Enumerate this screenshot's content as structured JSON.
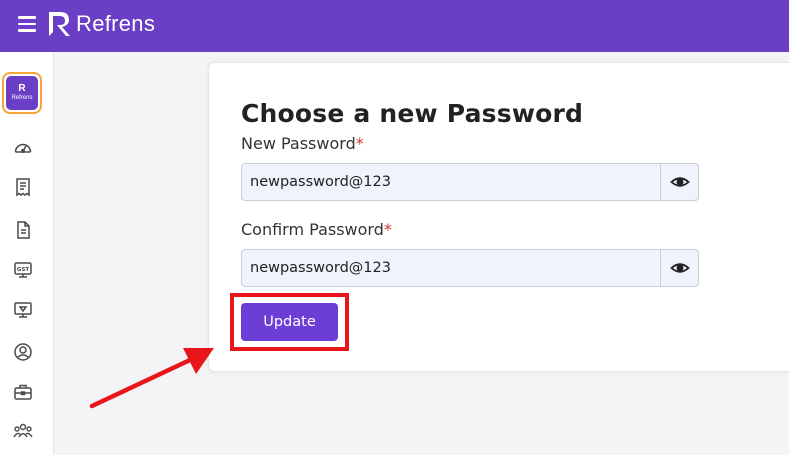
{
  "app": {
    "name": "Refrens",
    "badge_mark": "R",
    "badge_text": "Refrens"
  },
  "sidebar": {
    "items": [
      {
        "icon": "dashboard-gauge-icon"
      },
      {
        "icon": "invoice-icon"
      },
      {
        "icon": "document-icon"
      },
      {
        "icon": "gst-icon",
        "label": "GST"
      },
      {
        "icon": "presentation-icon"
      },
      {
        "icon": "user-circle-icon"
      },
      {
        "icon": "briefcase-icon"
      },
      {
        "icon": "team-icon"
      }
    ]
  },
  "form": {
    "title": "Choose a new Password",
    "new_password": {
      "label": "New Password",
      "required_mark": "*",
      "value": "newpassword@123"
    },
    "confirm_password": {
      "label": "Confirm Password",
      "required_mark": "*",
      "value": "newpassword@123"
    },
    "submit_label": "Update"
  },
  "colors": {
    "brand": "#6a3fc5",
    "button": "#6d3ed6",
    "annotation": "#e8151b",
    "required": "#d0342c"
  }
}
